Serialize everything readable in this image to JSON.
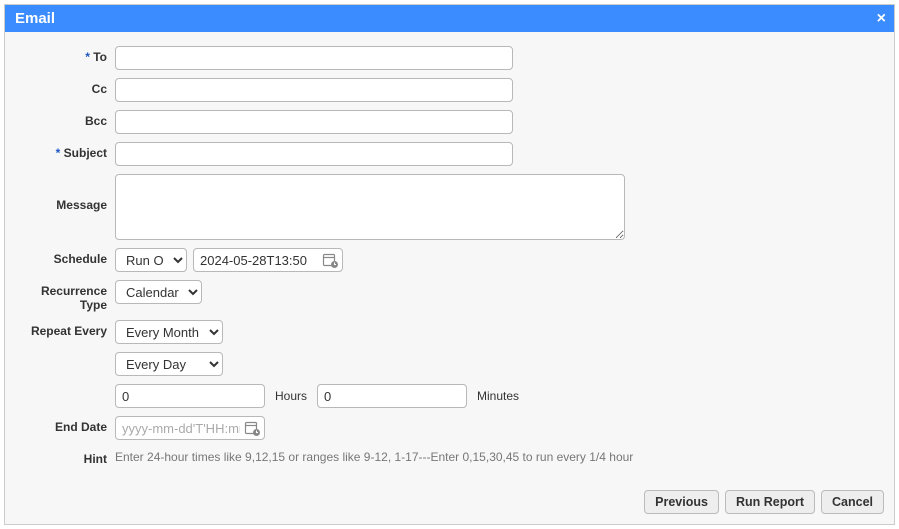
{
  "title": "Email",
  "close_glyph": "×",
  "required_marker": "*",
  "fields": {
    "to_label": "To",
    "to_value": "",
    "cc_label": "Cc",
    "cc_value": "",
    "bcc_label": "Bcc",
    "bcc_value": "",
    "subject_label": "Subject",
    "subject_value": "",
    "message_label": "Message",
    "message_value": ""
  },
  "schedule": {
    "label": "Schedule",
    "mode_options": [
      "Run On"
    ],
    "mode_selected": "Run On",
    "datetime_value": "2024-05-28T13:50"
  },
  "recurrence": {
    "type_label": "Recurrence Type",
    "type_options": [
      "Calendar"
    ],
    "type_selected": "Calendar",
    "repeat_label": "Repeat Every",
    "month_options": [
      "Every Month"
    ],
    "month_selected": "Every Month",
    "day_options": [
      "Every Day"
    ],
    "day_selected": "Every Day",
    "hours_value": "0",
    "hours_label": "Hours",
    "minutes_value": "0",
    "minutes_label": "Minutes"
  },
  "end_date": {
    "label": "End Date",
    "placeholder": "yyyy-mm-dd'T'HH:mm",
    "value": ""
  },
  "hint": {
    "label": "Hint",
    "text": "Enter 24-hour times like 9,12,15 or ranges like 9-12, 1-17---Enter 0,15,30,45 to run every 1/4 hour"
  },
  "buttons": {
    "previous": "Previous",
    "run_report": "Run Report",
    "cancel": "Cancel"
  }
}
